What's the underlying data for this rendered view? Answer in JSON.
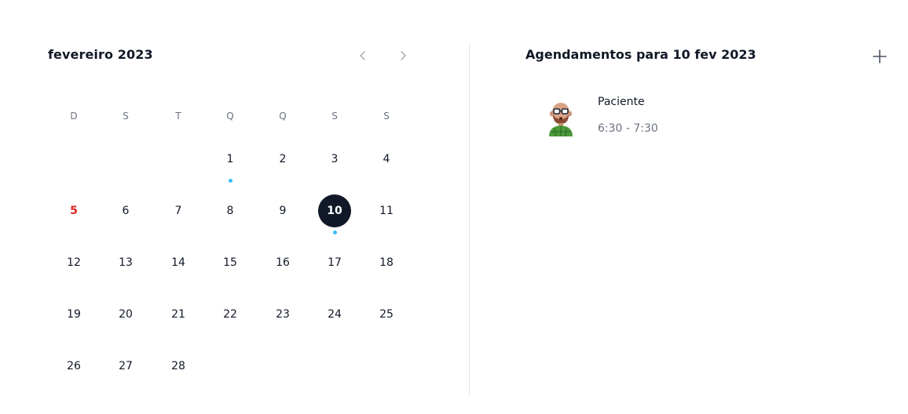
{
  "calendar": {
    "month_title": "fevereiro 2023",
    "prev_icon": "chevron-left-icon",
    "next_icon": "chevron-right-icon",
    "weekdays": [
      "D",
      "S",
      "T",
      "Q",
      "Q",
      "S",
      "S"
    ],
    "weeks": [
      [
        "",
        "",
        "",
        "1",
        "2",
        "3",
        "4"
      ],
      [
        "5",
        "6",
        "7",
        "8",
        "9",
        "10",
        "11"
      ],
      [
        "12",
        "13",
        "14",
        "15",
        "16",
        "17",
        "18"
      ],
      [
        "19",
        "20",
        "21",
        "22",
        "23",
        "24",
        "25"
      ],
      [
        "26",
        "27",
        "28",
        "",
        "",
        "",
        ""
      ]
    ],
    "selected_day": "10",
    "highlighted_sunday": "5",
    "days_with_events": [
      "1",
      "10"
    ],
    "colors": {
      "selected_bg": "#111827",
      "event_dot": "#38bdf8",
      "sunday_highlight": "#dc2626"
    }
  },
  "appointments": {
    "title": "Agendamentos para 10 fev 2023",
    "add_icon": "plus-icon",
    "items": [
      {
        "name": "Paciente",
        "time": "6:30 - 7:30",
        "avatar_icon": "patient-avatar-icon"
      }
    ]
  }
}
